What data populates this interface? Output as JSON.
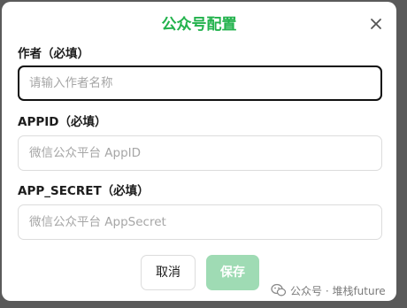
{
  "dialog": {
    "title": "公众号配置",
    "close_icon": "close-icon",
    "fields": [
      {
        "label": "作者（必填）",
        "placeholder": "请输入作者名称",
        "value": ""
      },
      {
        "label": "APPID（必填）",
        "placeholder": "微信公众平台 AppID",
        "value": ""
      },
      {
        "label": "APP_SECRET（必填）",
        "placeholder": "微信公众平台 AppSecret",
        "value": ""
      }
    ],
    "cancel_label": "取消",
    "save_label": "保存"
  },
  "watermark": {
    "icon": "wechat-icon",
    "text": "公众号 · 堆栈future"
  },
  "colors": {
    "title": "#22b24c",
    "save_button": "#9fdbb4",
    "focus_border": "#111111"
  }
}
